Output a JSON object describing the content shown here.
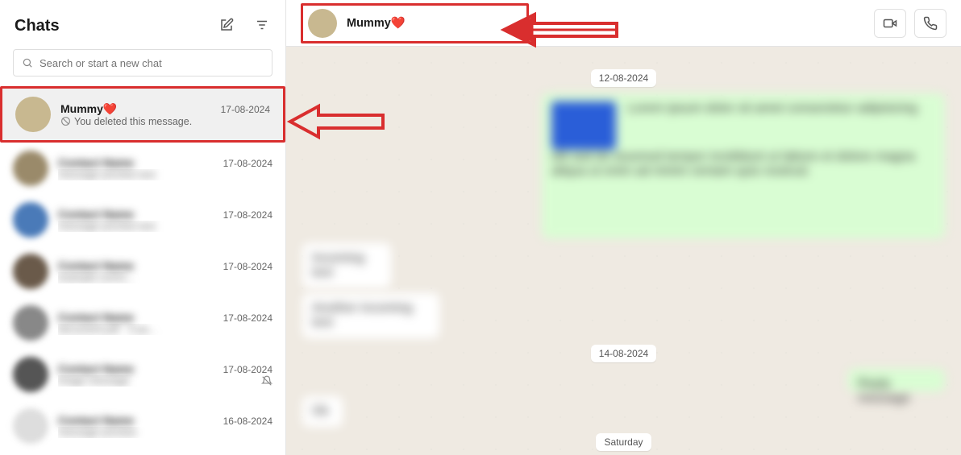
{
  "sidebar": {
    "title": "Chats",
    "search_placeholder": "Search or start a new chat"
  },
  "chats": [
    {
      "name": "Mummy❤️",
      "date": "17-08-2024",
      "preview": "You deleted this message."
    },
    {
      "name": "Contact Name",
      "date": "17-08-2024",
      "preview": "message preview text"
    },
    {
      "name": "Contact Name",
      "date": "17-08-2024",
      "preview": "message preview text"
    },
    {
      "name": "Contact Name",
      "date": "17-08-2024",
      "preview": "example.com/s..."
    },
    {
      "name": "Contact Name",
      "date": "17-08-2024",
      "preview": "document.pdf · 4 pa..."
    },
    {
      "name": "Contact Name",
      "date": "17-08-2024",
      "preview": "image message"
    },
    {
      "name": "Contact Name",
      "date": "16-08-2024",
      "preview": "message preview"
    }
  ],
  "header": {
    "contact_name": "Mummy❤️"
  },
  "dates": {
    "d1": "12-08-2024",
    "d2": "14-08-2024",
    "d3": "Saturday"
  },
  "annotations": {
    "arrow1": "highlight-arrow",
    "arrow2": "highlight-arrow"
  }
}
